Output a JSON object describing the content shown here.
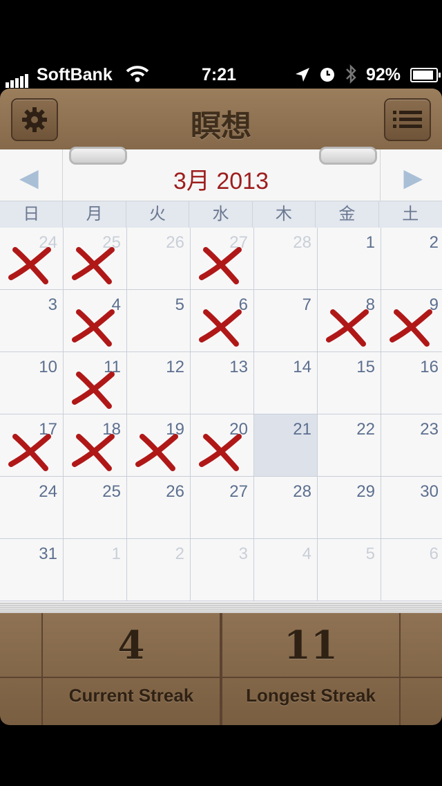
{
  "status": {
    "carrier": "SoftBank",
    "time": "7:21",
    "battery": "92%",
    "battery_level": 0.92
  },
  "header": {
    "title": "瞑想"
  },
  "calendar": {
    "month_title": "3月 2013",
    "weekdays": [
      "日",
      "月",
      "火",
      "水",
      "木",
      "金",
      "土"
    ],
    "accent": "#9e1d1d",
    "mark_color": "#b01818",
    "weeks": [
      [
        {
          "d": "24",
          "m": true,
          "x": true
        },
        {
          "d": "25",
          "m": true,
          "x": true
        },
        {
          "d": "26",
          "m": true
        },
        {
          "d": "27",
          "m": true,
          "x": true
        },
        {
          "d": "28",
          "m": true
        },
        {
          "d": "1"
        },
        {
          "d": "2"
        }
      ],
      [
        {
          "d": "3"
        },
        {
          "d": "4",
          "x": true
        },
        {
          "d": "5"
        },
        {
          "d": "6",
          "x": true
        },
        {
          "d": "7"
        },
        {
          "d": "8",
          "x": true
        },
        {
          "d": "9",
          "x": true
        }
      ],
      [
        {
          "d": "10"
        },
        {
          "d": "11",
          "x": true
        },
        {
          "d": "12"
        },
        {
          "d": "13"
        },
        {
          "d": "14"
        },
        {
          "d": "15"
        },
        {
          "d": "16"
        }
      ],
      [
        {
          "d": "17",
          "x": true
        },
        {
          "d": "18",
          "x": true
        },
        {
          "d": "19",
          "x": true
        },
        {
          "d": "20",
          "x": true
        },
        {
          "d": "21",
          "today": true
        },
        {
          "d": "22"
        },
        {
          "d": "23"
        }
      ],
      [
        {
          "d": "24"
        },
        {
          "d": "25"
        },
        {
          "d": "26"
        },
        {
          "d": "27"
        },
        {
          "d": "28"
        },
        {
          "d": "29"
        },
        {
          "d": "30"
        }
      ],
      [
        {
          "d": "31"
        },
        {
          "d": "1",
          "m": true
        },
        {
          "d": "2",
          "m": true
        },
        {
          "d": "3",
          "m": true
        },
        {
          "d": "4",
          "m": true
        },
        {
          "d": "5",
          "m": true
        },
        {
          "d": "6",
          "m": true
        }
      ]
    ]
  },
  "stats": {
    "current_streak": "4",
    "current_label": "Current Streak",
    "longest_streak": "11",
    "longest_label": "Longest Streak"
  }
}
